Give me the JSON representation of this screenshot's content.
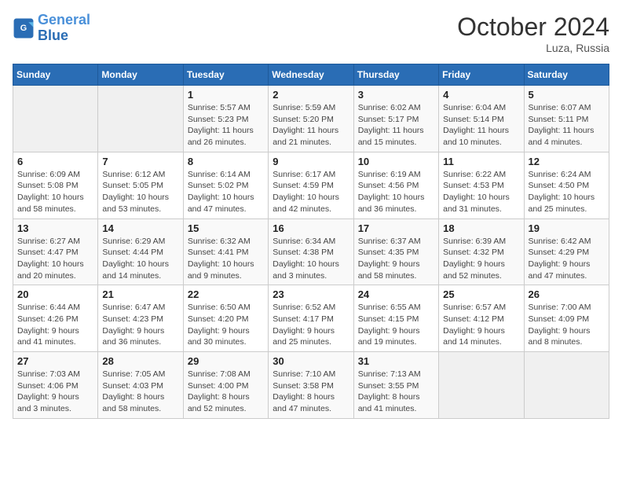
{
  "logo": {
    "line1": "General",
    "line2": "Blue"
  },
  "title": "October 2024",
  "location": "Luza, Russia",
  "days_header": [
    "Sunday",
    "Monday",
    "Tuesday",
    "Wednesday",
    "Thursday",
    "Friday",
    "Saturday"
  ],
  "weeks": [
    [
      {
        "day": "",
        "info": ""
      },
      {
        "day": "",
        "info": ""
      },
      {
        "day": "1",
        "info": "Sunrise: 5:57 AM\nSunset: 5:23 PM\nDaylight: 11 hours and 26 minutes."
      },
      {
        "day": "2",
        "info": "Sunrise: 5:59 AM\nSunset: 5:20 PM\nDaylight: 11 hours and 21 minutes."
      },
      {
        "day": "3",
        "info": "Sunrise: 6:02 AM\nSunset: 5:17 PM\nDaylight: 11 hours and 15 minutes."
      },
      {
        "day": "4",
        "info": "Sunrise: 6:04 AM\nSunset: 5:14 PM\nDaylight: 11 hours and 10 minutes."
      },
      {
        "day": "5",
        "info": "Sunrise: 6:07 AM\nSunset: 5:11 PM\nDaylight: 11 hours and 4 minutes."
      }
    ],
    [
      {
        "day": "6",
        "info": "Sunrise: 6:09 AM\nSunset: 5:08 PM\nDaylight: 10 hours and 58 minutes."
      },
      {
        "day": "7",
        "info": "Sunrise: 6:12 AM\nSunset: 5:05 PM\nDaylight: 10 hours and 53 minutes."
      },
      {
        "day": "8",
        "info": "Sunrise: 6:14 AM\nSunset: 5:02 PM\nDaylight: 10 hours and 47 minutes."
      },
      {
        "day": "9",
        "info": "Sunrise: 6:17 AM\nSunset: 4:59 PM\nDaylight: 10 hours and 42 minutes."
      },
      {
        "day": "10",
        "info": "Sunrise: 6:19 AM\nSunset: 4:56 PM\nDaylight: 10 hours and 36 minutes."
      },
      {
        "day": "11",
        "info": "Sunrise: 6:22 AM\nSunset: 4:53 PM\nDaylight: 10 hours and 31 minutes."
      },
      {
        "day": "12",
        "info": "Sunrise: 6:24 AM\nSunset: 4:50 PM\nDaylight: 10 hours and 25 minutes."
      }
    ],
    [
      {
        "day": "13",
        "info": "Sunrise: 6:27 AM\nSunset: 4:47 PM\nDaylight: 10 hours and 20 minutes."
      },
      {
        "day": "14",
        "info": "Sunrise: 6:29 AM\nSunset: 4:44 PM\nDaylight: 10 hours and 14 minutes."
      },
      {
        "day": "15",
        "info": "Sunrise: 6:32 AM\nSunset: 4:41 PM\nDaylight: 10 hours and 9 minutes."
      },
      {
        "day": "16",
        "info": "Sunrise: 6:34 AM\nSunset: 4:38 PM\nDaylight: 10 hours and 3 minutes."
      },
      {
        "day": "17",
        "info": "Sunrise: 6:37 AM\nSunset: 4:35 PM\nDaylight: 9 hours and 58 minutes."
      },
      {
        "day": "18",
        "info": "Sunrise: 6:39 AM\nSunset: 4:32 PM\nDaylight: 9 hours and 52 minutes."
      },
      {
        "day": "19",
        "info": "Sunrise: 6:42 AM\nSunset: 4:29 PM\nDaylight: 9 hours and 47 minutes."
      }
    ],
    [
      {
        "day": "20",
        "info": "Sunrise: 6:44 AM\nSunset: 4:26 PM\nDaylight: 9 hours and 41 minutes."
      },
      {
        "day": "21",
        "info": "Sunrise: 6:47 AM\nSunset: 4:23 PM\nDaylight: 9 hours and 36 minutes."
      },
      {
        "day": "22",
        "info": "Sunrise: 6:50 AM\nSunset: 4:20 PM\nDaylight: 9 hours and 30 minutes."
      },
      {
        "day": "23",
        "info": "Sunrise: 6:52 AM\nSunset: 4:17 PM\nDaylight: 9 hours and 25 minutes."
      },
      {
        "day": "24",
        "info": "Sunrise: 6:55 AM\nSunset: 4:15 PM\nDaylight: 9 hours and 19 minutes."
      },
      {
        "day": "25",
        "info": "Sunrise: 6:57 AM\nSunset: 4:12 PM\nDaylight: 9 hours and 14 minutes."
      },
      {
        "day": "26",
        "info": "Sunrise: 7:00 AM\nSunset: 4:09 PM\nDaylight: 9 hours and 8 minutes."
      }
    ],
    [
      {
        "day": "27",
        "info": "Sunrise: 7:03 AM\nSunset: 4:06 PM\nDaylight: 9 hours and 3 minutes."
      },
      {
        "day": "28",
        "info": "Sunrise: 7:05 AM\nSunset: 4:03 PM\nDaylight: 8 hours and 58 minutes."
      },
      {
        "day": "29",
        "info": "Sunrise: 7:08 AM\nSunset: 4:00 PM\nDaylight: 8 hours and 52 minutes."
      },
      {
        "day": "30",
        "info": "Sunrise: 7:10 AM\nSunset: 3:58 PM\nDaylight: 8 hours and 47 minutes."
      },
      {
        "day": "31",
        "info": "Sunrise: 7:13 AM\nSunset: 3:55 PM\nDaylight: 8 hours and 41 minutes."
      },
      {
        "day": "",
        "info": ""
      },
      {
        "day": "",
        "info": ""
      }
    ]
  ]
}
